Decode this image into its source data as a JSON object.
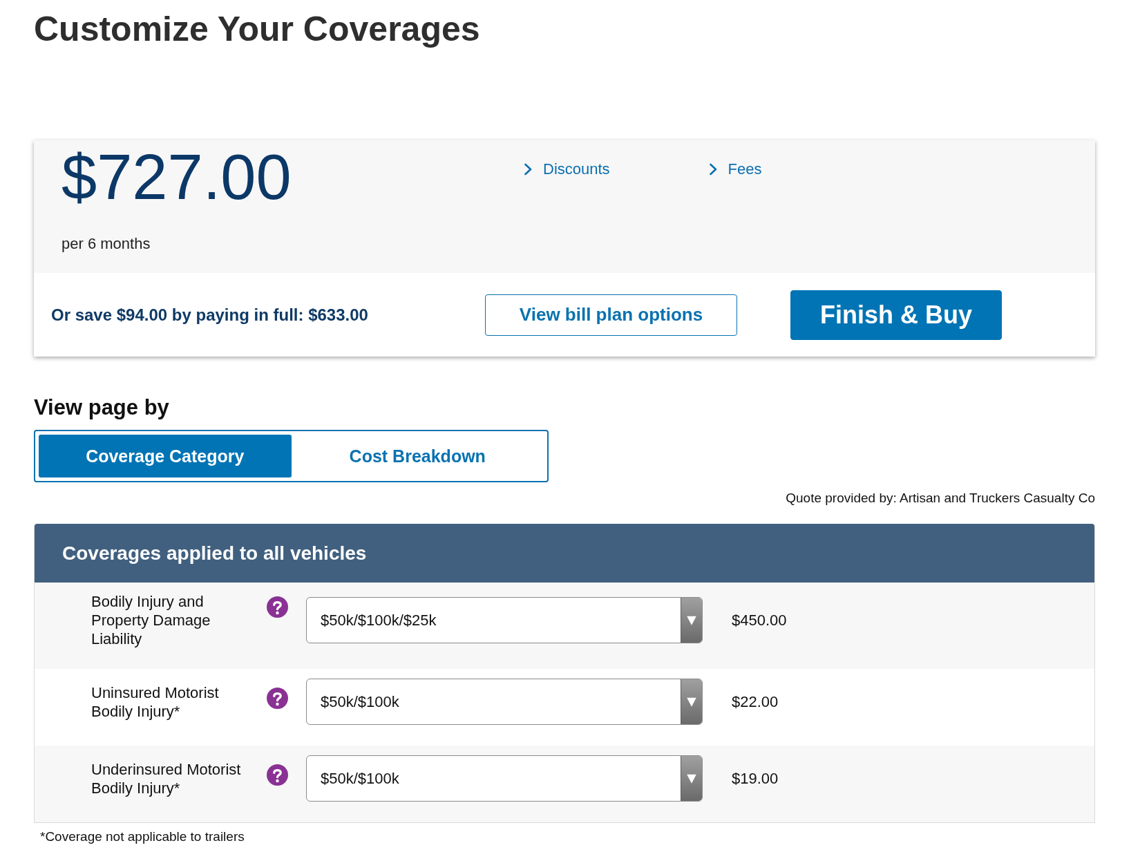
{
  "page_title": "Customize Your Coverages",
  "summary": {
    "price": "$727.00",
    "term": "per 6 months",
    "links": [
      "Discounts",
      "Fees"
    ],
    "pay_in_full": "Or save $94.00 by paying in full: $633.00",
    "buttons": [
      {
        "label": "View bill plan options",
        "kind": "outline"
      },
      {
        "label": "Finish & Buy",
        "kind": "primary"
      }
    ]
  },
  "view_by": {
    "title": "View page by",
    "options": [
      {
        "label": "Coverage Category",
        "selected": true
      },
      {
        "label": "Cost Breakdown",
        "selected": false
      }
    ]
  },
  "quote_provider": "Quote provided by: Artisan and Truckers Casualty Co",
  "coverage_section": {
    "title": "Coverages applied to all vehicles",
    "rows": [
      {
        "label": "Bodily Injury and Property Damage Liability",
        "value": "$50k/$100k/$25k",
        "premium": "$450.00"
      },
      {
        "label": "Uninsured Motorist Bodily Injury*",
        "value": "$50k/$100k",
        "premium": "$22.00"
      },
      {
        "label": "Underinsured Motorist Bodily Injury*",
        "value": "$50k/$100k",
        "premium": "$19.00"
      }
    ]
  },
  "footnote": "*Coverage not applicable to trailers"
}
